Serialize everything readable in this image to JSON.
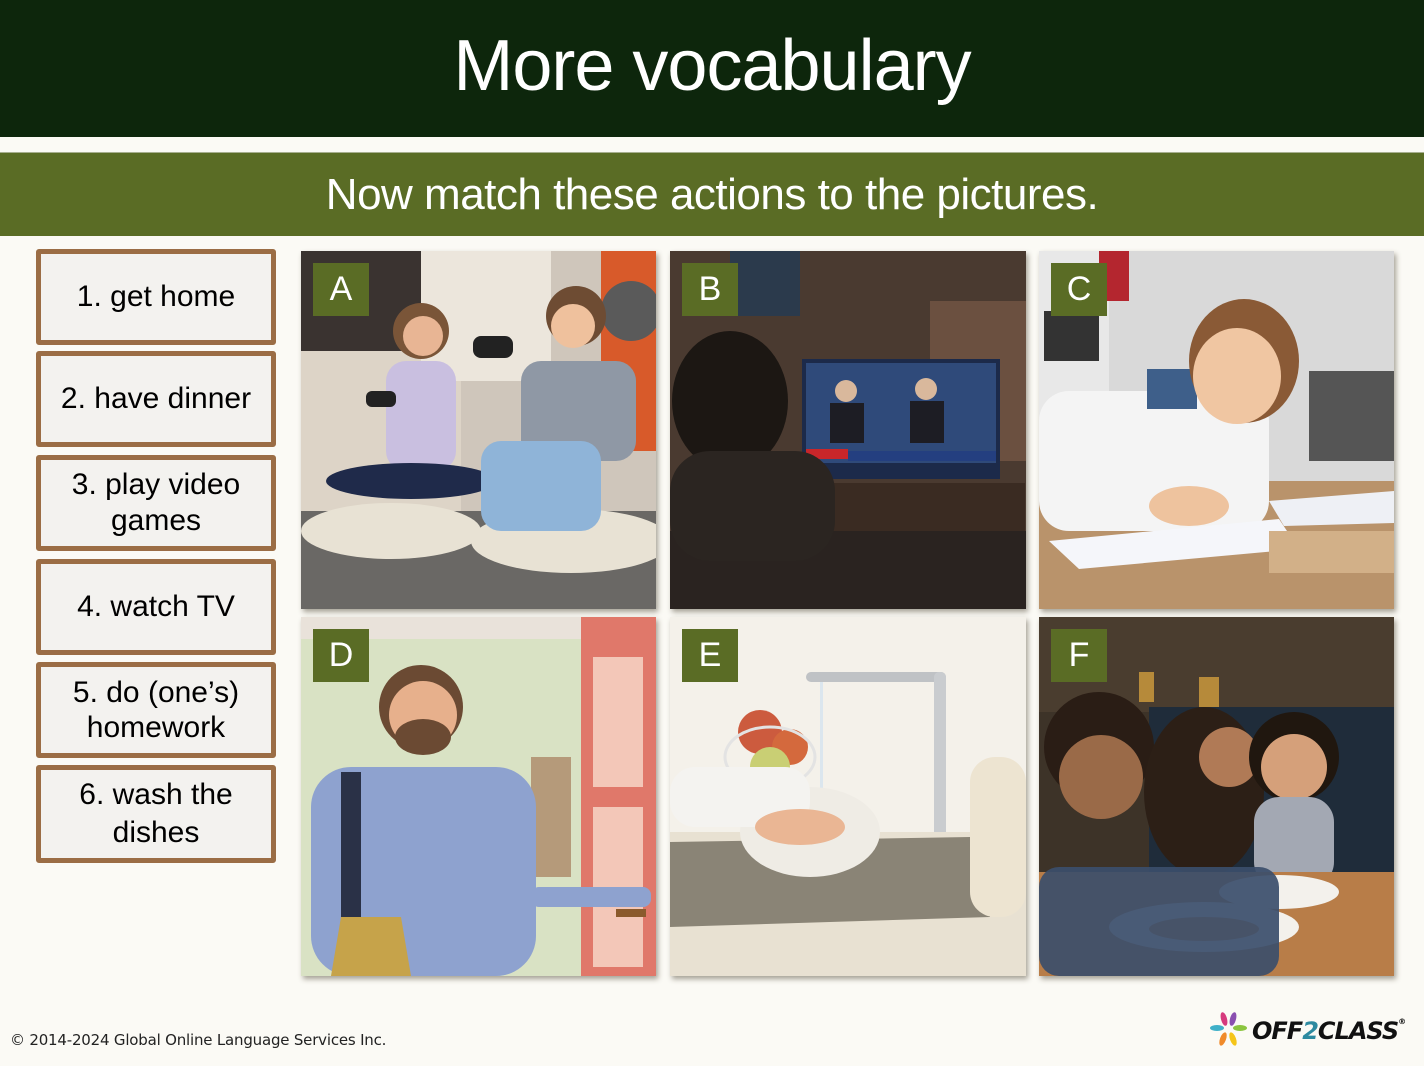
{
  "header": {
    "title": "More vocabulary",
    "instruction": "Now match these actions to the pictures."
  },
  "actions": [
    {
      "number": "1.",
      "text": "1. get home"
    },
    {
      "number": "2.",
      "text": "2. have dinner"
    },
    {
      "number": "3.",
      "text": "3. play video games"
    },
    {
      "number": "4.",
      "text": "4. watch TV"
    },
    {
      "number": "5.",
      "text": "5. do (one’s) homework"
    },
    {
      "number": "6.",
      "text": "6. wash the dishes"
    }
  ],
  "pictures": [
    {
      "letter": "A",
      "description": "two children playing video games with controllers"
    },
    {
      "letter": "B",
      "description": "person watching news on TV in dim living room"
    },
    {
      "letter": "C",
      "description": "boy writing in notebook at desk"
    },
    {
      "letter": "D",
      "description": "smiling man with bag entering through front door"
    },
    {
      "letter": "E",
      "description": "hands washing a plate under kitchen faucet"
    },
    {
      "letter": "F",
      "description": "family eating pasta together at table"
    }
  ],
  "footer": {
    "copyright": "© 2014-2024 Global Online Language Services Inc.",
    "logo_pre": "OFF",
    "logo_two": "2",
    "logo_post": "CLASS",
    "logo_reg": "®"
  },
  "colors": {
    "title_bar": "#0d260c",
    "instruction_bar": "#5a6c25",
    "box_border": "#9b6d45",
    "letter_badge": "#5a6c25"
  }
}
